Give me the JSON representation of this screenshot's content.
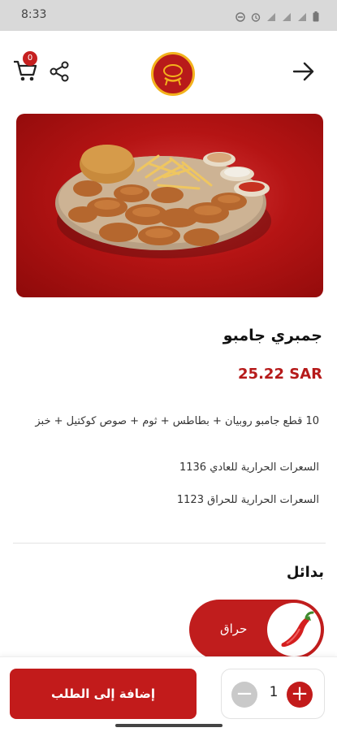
{
  "status_bar": {
    "time": "8:33"
  },
  "header": {
    "cart_count": "0"
  },
  "product": {
    "name": "جمبري جامبو",
    "price": "25.22 SAR",
    "description": "10 قطع جامبو روبيان + بطاطس + ثوم + صوص كوكتيل + خبز",
    "calories_regular": "السعرات الحرارية للعادي 1136",
    "calories_spicy": "السعرات الحرارية للحراق 1123"
  },
  "alternatives": {
    "title": "بدائل",
    "items": [
      {
        "label": "حراق"
      }
    ]
  },
  "bottom_bar": {
    "add_label": "إضافة إلى الطلب",
    "quantity": "1"
  }
}
